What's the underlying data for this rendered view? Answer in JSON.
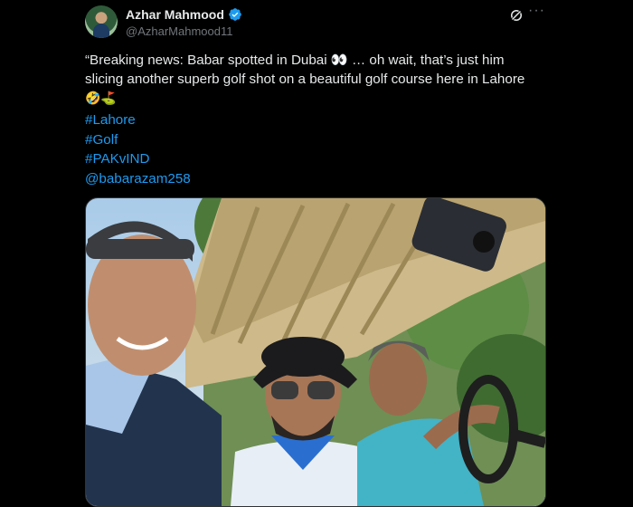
{
  "tweet": {
    "author": {
      "display_name": "Azhar Mahmood",
      "handle": "@AzharMahmood11",
      "verified_icon": "verified-badge-icon"
    },
    "text_line1": "“Breaking news: Babar spotted in Dubai 👀 … oh wait, that’s just him",
    "text_line2": "slicing another superb golf shot on a beautiful golf course here in Lahore",
    "text_line3": "🤣⛳",
    "hashtags": [
      "#Lahore",
      "#Golf",
      "#PAKvIND"
    ],
    "mention": "@babarazam258",
    "media": {
      "image_icon": "photo-golf-cart-selfie"
    }
  },
  "colors": {
    "background": "#000000",
    "text": "#e7e9ea",
    "muted": "#71767b",
    "link": "#1d9bf0",
    "verified": "#1d9bf0"
  }
}
